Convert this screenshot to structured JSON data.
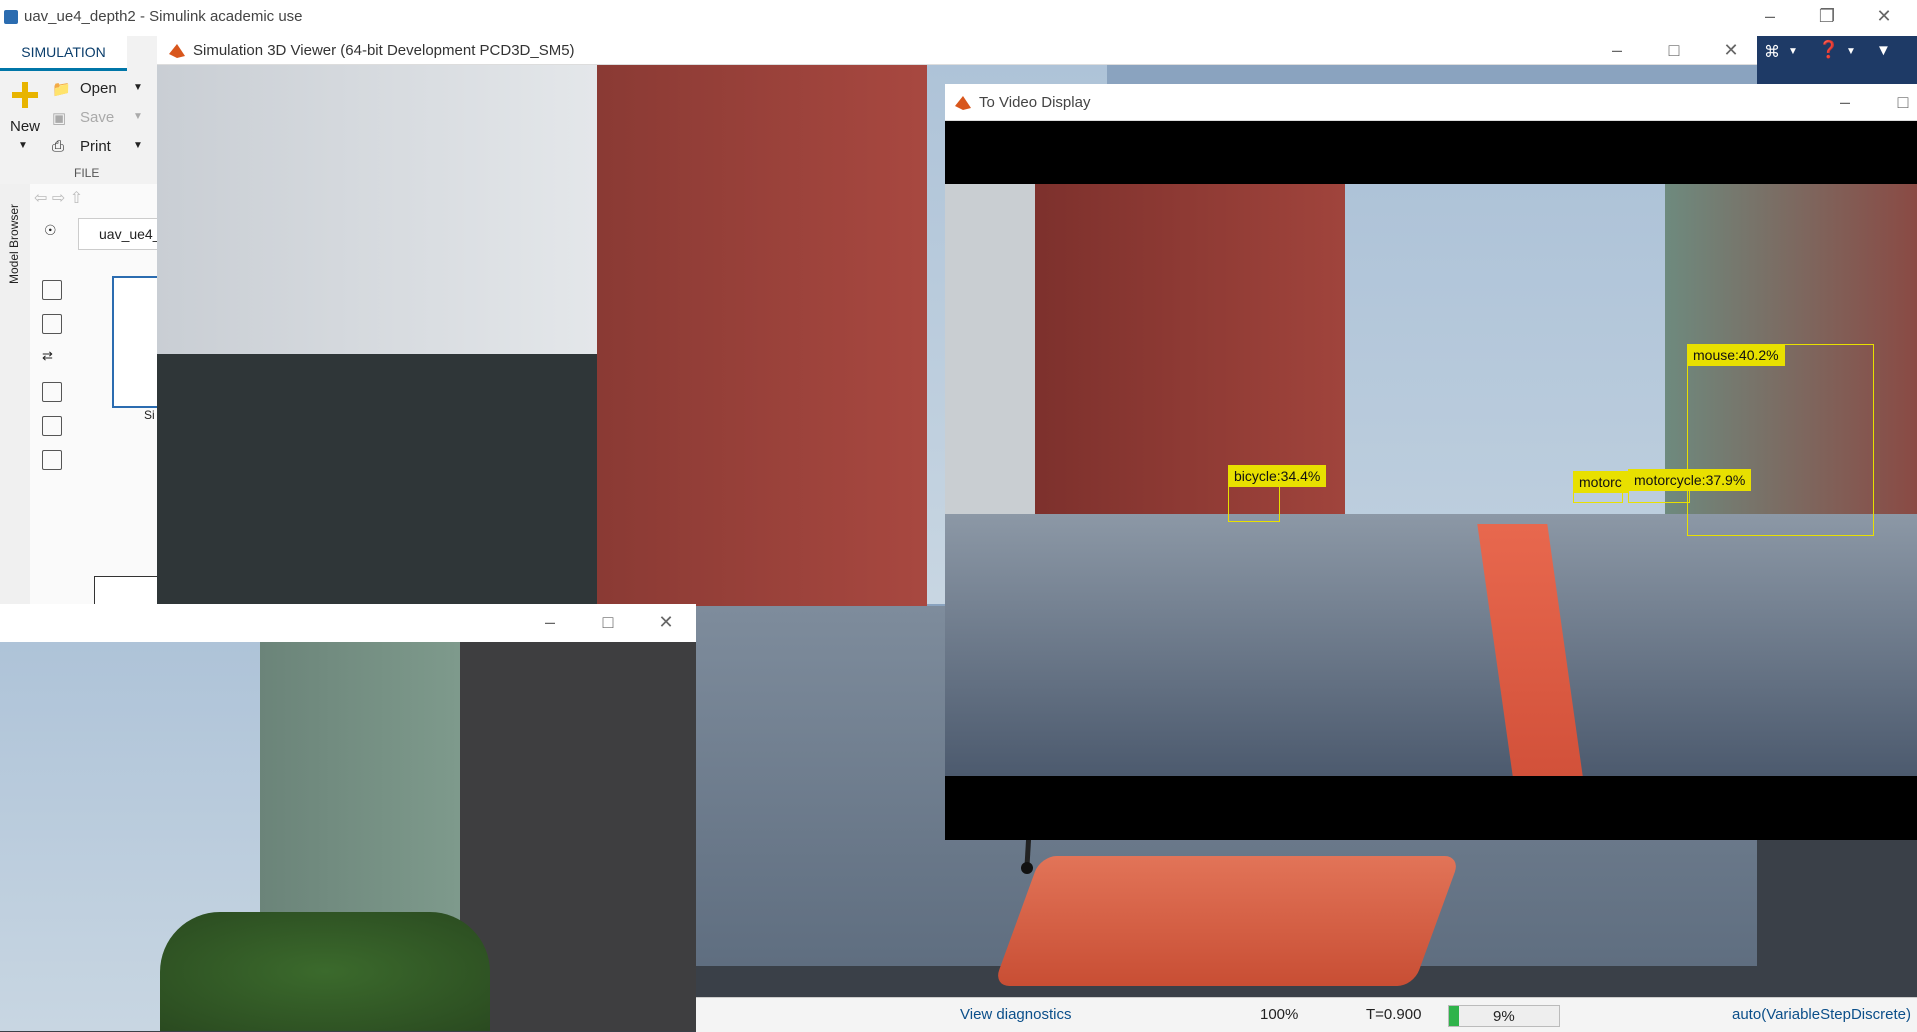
{
  "simulink": {
    "window_title": "uav_ue4_depth2 - Simulink academic use",
    "tab": "SIMULATION",
    "new_label": "New",
    "open_label": "Open",
    "save_label": "Save",
    "print_label": "Print",
    "file_section": "FILE",
    "model_browser_label": "Model Browser",
    "breadcrumb": "uav_ue4_",
    "block_label_fragment": "Si"
  },
  "viewer": {
    "title": "Simulation 3D Viewer (64-bit Development PCD3D_SM5)"
  },
  "video_display": {
    "title": "To Video Display",
    "detections": [
      {
        "label": "mouse:40.2%"
      },
      {
        "label": "bicycle:34.4%"
      },
      {
        "label": "motorcycle:37.9%"
      },
      {
        "label": "motorc"
      }
    ]
  },
  "status_bar": {
    "diagnostics": "View diagnostics",
    "zoom": "100%",
    "time": "T=0.900",
    "progress_text": "9%",
    "progress_fraction": 0.09,
    "solver": "auto(VariableStepDiscrete)"
  },
  "colors": {
    "accent": "#0076a8",
    "detection": "#e8e000",
    "progress": "#2fb34a"
  }
}
